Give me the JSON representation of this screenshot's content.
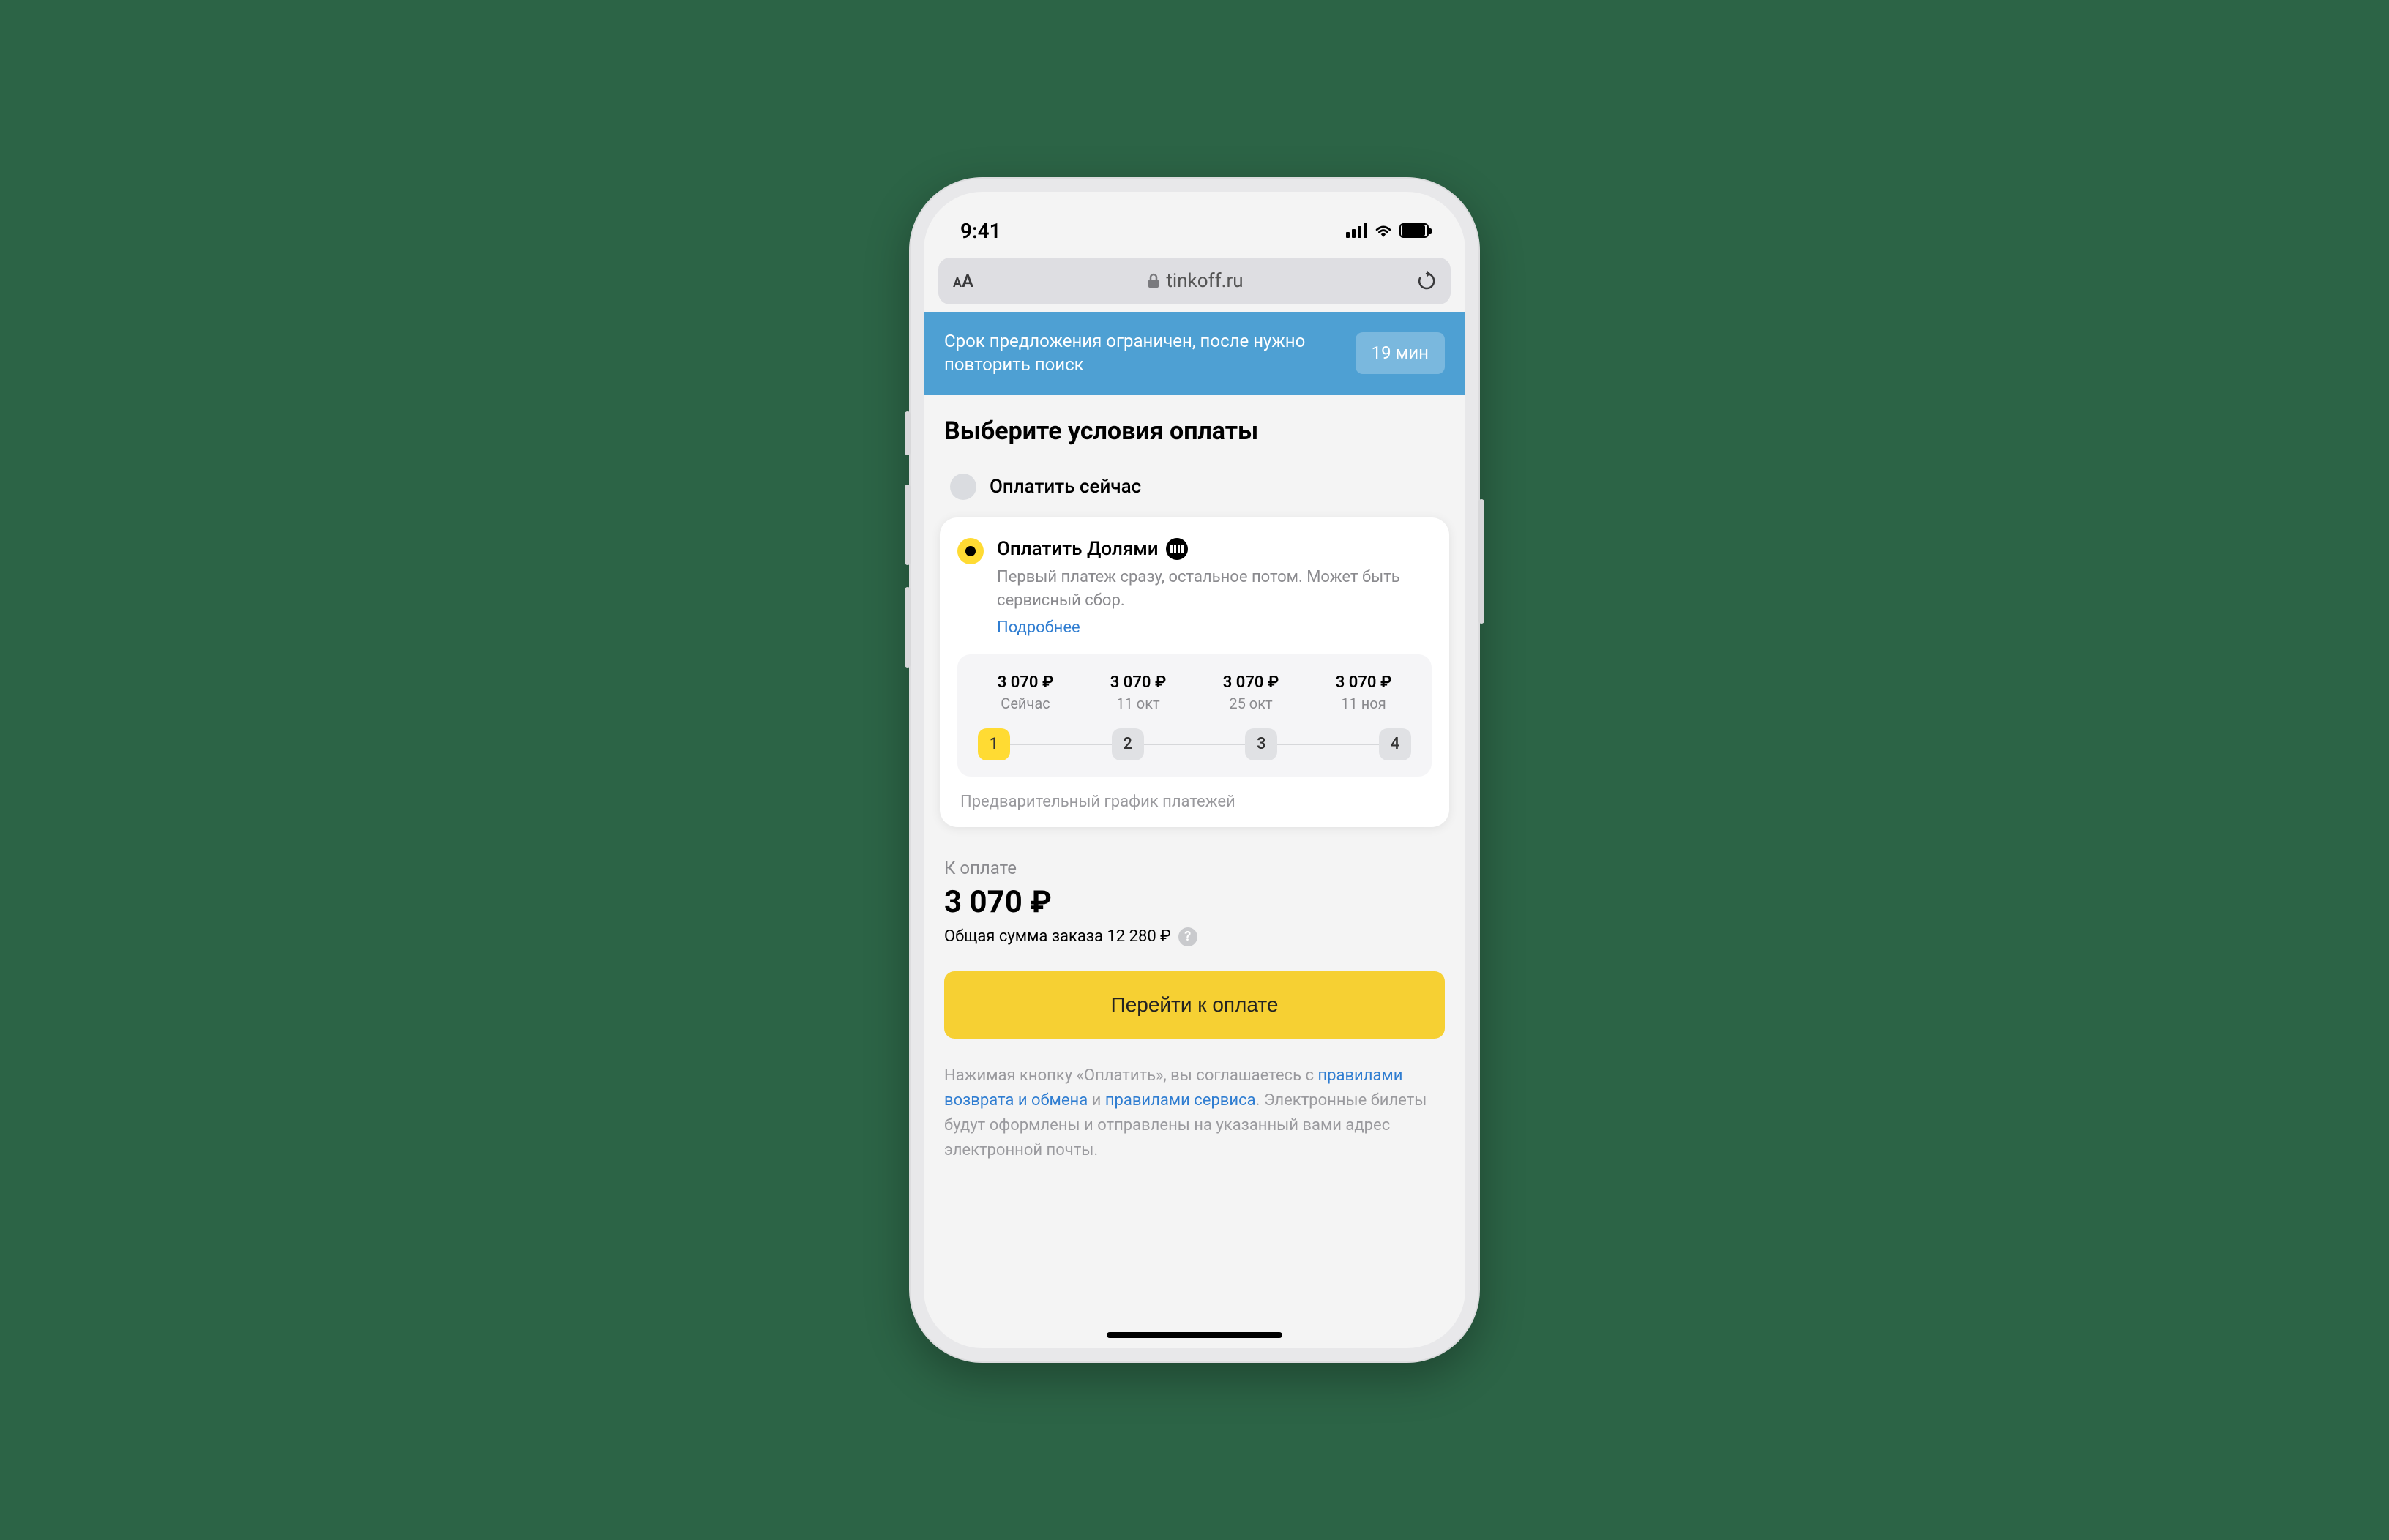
{
  "statusbar": {
    "time": "9:41"
  },
  "urlbar": {
    "aa_small": "A",
    "aa_big": "A",
    "domain": "tinkoff.ru"
  },
  "banner": {
    "text": "Срок предложения ограничен, после нужно повторить поиск",
    "timer": "19 мин"
  },
  "heading": "Выберите условия оплаты",
  "options": {
    "pay_now": "Оплатить сейчас",
    "pay_install": "Оплатить Долями",
    "install_desc": "Первый платеж сразу, остальное потом. Может быть сервисный сбор.",
    "install_more": "Подробнее"
  },
  "schedule": {
    "cols": [
      {
        "amount": "3 070 ₽",
        "when": "Сейчас",
        "step": "1"
      },
      {
        "amount": "3 070 ₽",
        "when": "11 окт",
        "step": "2"
      },
      {
        "amount": "3 070 ₽",
        "when": "25 окт",
        "step": "3"
      },
      {
        "amount": "3 070 ₽",
        "when": "11 ноя",
        "step": "4"
      }
    ],
    "note": "Предварительный график платежей"
  },
  "totals": {
    "label": "К оплате",
    "amount": "3 070 ₽",
    "subline": "Общая сумма заказа 12 280 ₽"
  },
  "cta": "Перейти к оплате",
  "terms": {
    "t1": "Нажимая кнопку «Оплатить», вы соглашаетесь с ",
    "link1": "правилами возврата и обмена",
    "t2": " и ",
    "link2": "правилами сервиса",
    "t3": ". Электронные билеты будут оформлены и отправлены на указанный вами адрес электронной почты."
  }
}
